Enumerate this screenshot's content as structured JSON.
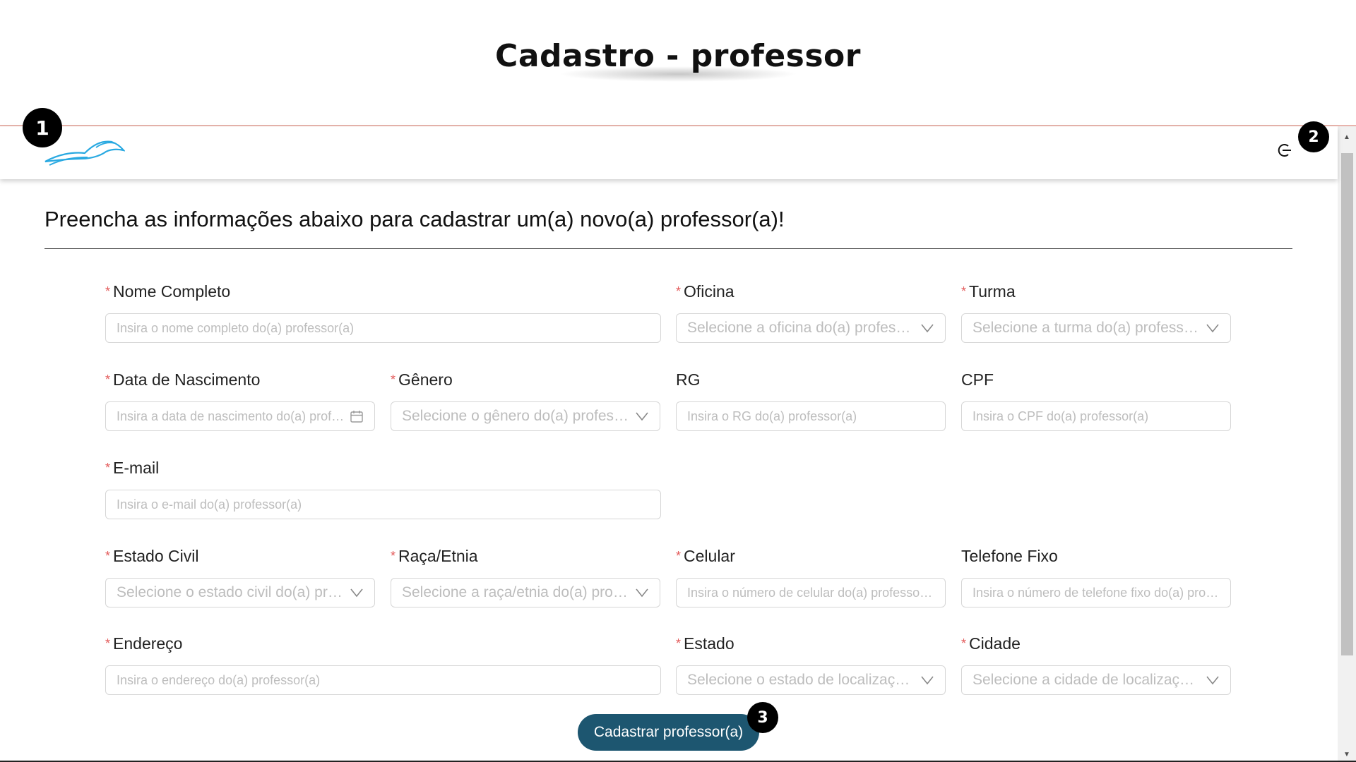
{
  "page_title": "Cadastro - professor",
  "heading": "Preencha as informações abaixo para cadastrar um(a) novo(a) professor(a)!",
  "badges": [
    "1",
    "2",
    "3"
  ],
  "colors": {
    "primary_button": "#1d5670",
    "required_mark": "#e35b5b",
    "logo": "#29a9e1"
  },
  "icons": {
    "logo": "bird-logo-icon",
    "logout": "logout-icon",
    "select": "chevron-down-icon",
    "date": "calendar-icon"
  },
  "form": {
    "nome": {
      "label": "Nome Completo",
      "placeholder": "Insira o nome completo do(a) professor(a)",
      "required": true
    },
    "oficina": {
      "label": "Oficina",
      "placeholder": "Selecione a oficina do(a) professor(a)",
      "required": true
    },
    "turma": {
      "label": "Turma",
      "placeholder": "Selecione a turma do(a) professor(a)",
      "required": true
    },
    "nascimento": {
      "label": "Data de Nascimento",
      "placeholder": "Insira a data de nascimento do(a) professor(a)",
      "required": true
    },
    "genero": {
      "label": "Gênero",
      "placeholder": "Selecione o gênero do(a) professor(a)",
      "required": true
    },
    "rg": {
      "label": "RG",
      "placeholder": "Insira o RG do(a) professor(a)",
      "required": false
    },
    "cpf": {
      "label": "CPF",
      "placeholder": "Insira o CPF do(a) professor(a)",
      "required": false
    },
    "email": {
      "label": "E-mail",
      "placeholder": "Insira o e-mail do(a) professor(a)",
      "required": true
    },
    "estado_civil": {
      "label": "Estado Civil",
      "placeholder": "Selecione o estado civil do(a) professor(a)",
      "required": true
    },
    "raca": {
      "label": "Raça/Etnia",
      "placeholder": "Selecione a raça/etnia do(a) professor(a)",
      "required": true
    },
    "celular": {
      "label": "Celular",
      "placeholder": "Insira o número de celular do(a) professor(a)",
      "required": true
    },
    "telefone": {
      "label": "Telefone Fixo",
      "placeholder": "Insira o número de telefone fixo do(a) professor(a)",
      "required": false
    },
    "endereco": {
      "label": "Endereço",
      "placeholder": "Insira o endereço do(a) professor(a)",
      "required": true
    },
    "estado": {
      "label": "Estado",
      "placeholder": "Selecione o estado de localização do(a) professor(a)",
      "required": true
    },
    "cidade": {
      "label": "Cidade",
      "placeholder": "Selecione a cidade de localização do(a) professor(a)",
      "required": true
    }
  },
  "submit_label": "Cadastrar professor(a)",
  "required_mark": "*"
}
